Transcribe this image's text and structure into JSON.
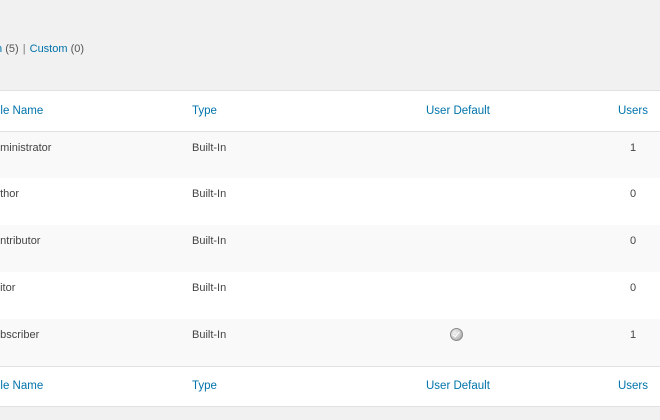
{
  "filters": {
    "builtin_label": "n",
    "builtin_count": "(5)",
    "separator": "|",
    "custom_label": "Custom",
    "custom_count": "(0)"
  },
  "table": {
    "headers": {
      "role_name": "ole Name",
      "type": "Type",
      "user_default": "User Default",
      "users": "Users"
    },
    "rows": [
      {
        "role": "dministrator",
        "type": "Built-In",
        "is_default": false,
        "users": "1"
      },
      {
        "role": "uthor",
        "type": "Built-In",
        "is_default": false,
        "users": "0"
      },
      {
        "role": "ontributor",
        "type": "Built-In",
        "is_default": false,
        "users": "0"
      },
      {
        "role": "ditor",
        "type": "Built-In",
        "is_default": false,
        "users": "0"
      },
      {
        "role": "ubscriber",
        "type": "Built-In",
        "is_default": true,
        "users": "1"
      }
    ]
  },
  "icons": {
    "default_marker": "check-circle-icon"
  },
  "colors": {
    "link": "#0073aa",
    "page_bg": "#f1f1f1",
    "row_alt": "#f9f9f9"
  }
}
